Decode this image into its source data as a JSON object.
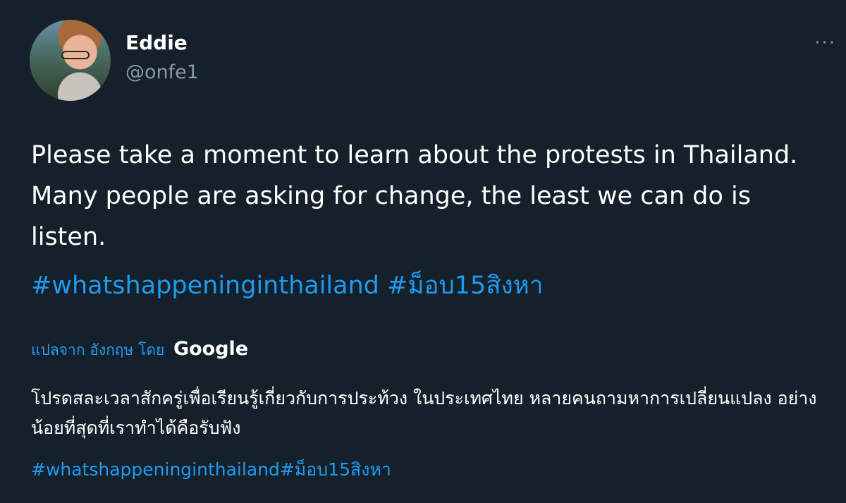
{
  "user": {
    "name": "Eddie",
    "handle": "@onfe1"
  },
  "menu": {
    "more_label": "···"
  },
  "tweet": {
    "text": "Please take a moment to learn about the protests in Thailand. Many people are asking for change, the least we can do is listen.",
    "hashtags": "#whatshappeninginthailand #ม็อบ15สิงหา"
  },
  "translation": {
    "label": "แปลจาก อังกฤษ โดย",
    "provider": "Google",
    "text": "โปรดสละเวลาสักครู่เพื่อเรียนรู้เกี่ยวกับการประท้วง ในประเทศไทย หลายคนถามหาการเปลี่ยนแปลง อย่างน้อยที่สุดที่เราทำได้คือรับฟัง",
    "hashtags": "#whatshappeninginthailand#ม็อบ15สิงหา"
  }
}
